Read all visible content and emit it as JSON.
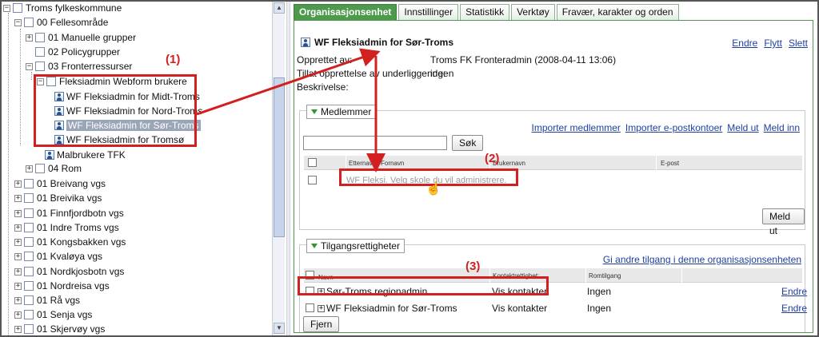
{
  "tree": {
    "items": [
      {
        "label": "Troms fylkeskommune",
        "toggle": "−"
      },
      {
        "label": "00 Fellesområde",
        "toggle": "−"
      },
      {
        "label": "01 Manuelle grupper",
        "toggle": "+"
      },
      {
        "label": "02 Policygrupper",
        "toggle": ""
      },
      {
        "label": "03 Fronterressurser",
        "toggle": "−"
      },
      {
        "label": "Fleksiadmin Webform brukere",
        "toggle": "−"
      },
      {
        "label": "WF Fleksiadmin for Midt-Troms",
        "toggle": ""
      },
      {
        "label": "WF Fleksiadmin for Nord-Troms",
        "toggle": ""
      },
      {
        "label": "WF Fleksiadmin for Sør-Troms",
        "toggle": ""
      },
      {
        "label": "WF Fleksiadmin for Tromsø",
        "toggle": ""
      },
      {
        "label": "Malbrukere TFK",
        "toggle": ""
      },
      {
        "label": "04 Rom",
        "toggle": "+"
      },
      {
        "label": "01 Breivang vgs",
        "toggle": "+"
      },
      {
        "label": "01 Breivika vgs",
        "toggle": "+"
      },
      {
        "label": "01 Finnfjordbotn vgs",
        "toggle": "+"
      },
      {
        "label": "01 Indre Troms vgs",
        "toggle": "+"
      },
      {
        "label": "01 Kongsbakken vgs",
        "toggle": "+"
      },
      {
        "label": "01 Kvaløya vgs",
        "toggle": "+"
      },
      {
        "label": "01 Nordkjosbotn vgs",
        "toggle": "+"
      },
      {
        "label": "01 Nordreisa vgs",
        "toggle": "+"
      },
      {
        "label": "01 Rå vgs",
        "toggle": "+"
      },
      {
        "label": "01 Senja vgs",
        "toggle": "+"
      },
      {
        "label": "01 Skjervøy vgs",
        "toggle": "+"
      }
    ]
  },
  "tabs": [
    "Organisasjonsenhet",
    "Innstillinger",
    "Statistikk",
    "Verktøy",
    "Fravær, karakter og orden"
  ],
  "object": {
    "title": "WF Fleksiadmin for Sør-Troms",
    "actions": [
      "Endre",
      "Flytt",
      "Slett"
    ],
    "created_by_label": "Opprettet av:",
    "created_by_value": "Troms FK Fronteradmin (2008-04-11 13:06)",
    "allow_sub_label": "Tillat opprettelse av underliggende:",
    "allow_sub_value": "ingen",
    "description_label": "Beskrivelse:"
  },
  "members": {
    "section_label": "Medlemmer",
    "links": [
      "Importer medlemmer",
      "Importer e-postkontoer",
      "Meld ut",
      "Meld inn"
    ],
    "search_button": "Søk",
    "search_value": "",
    "columns": [
      "Etternavn",
      "Fornavn",
      "Brukernavn",
      "E-post"
    ],
    "row_text": "WF Fleksi. Velg skole du vil administrere.",
    "leave_button": "Meld ut"
  },
  "access": {
    "section_label": "Tilgangsrettigheter",
    "grant_link": "Gi andre tilgang i denne organisasjonsenheten",
    "columns": [
      "Navn",
      "Kontaktrettighet:",
      "Romtilgang"
    ],
    "rows": [
      {
        "name": "Sør-Troms regionadmin",
        "contact": "Vis kontakter",
        "room": "Ingen",
        "action": "Endre"
      },
      {
        "name": "WF Fleksiadmin for Sør-Troms",
        "contact": "Vis kontakter",
        "room": "Ingen",
        "action": "Endre"
      }
    ],
    "remove_button": "Fjern"
  },
  "annotations": [
    "(1)",
    "(2)",
    "(3)"
  ],
  "colors": {
    "accent_green": "#4d9a4d",
    "callout_red": "#d21f1f",
    "link_blue": "#1f3fa0"
  }
}
